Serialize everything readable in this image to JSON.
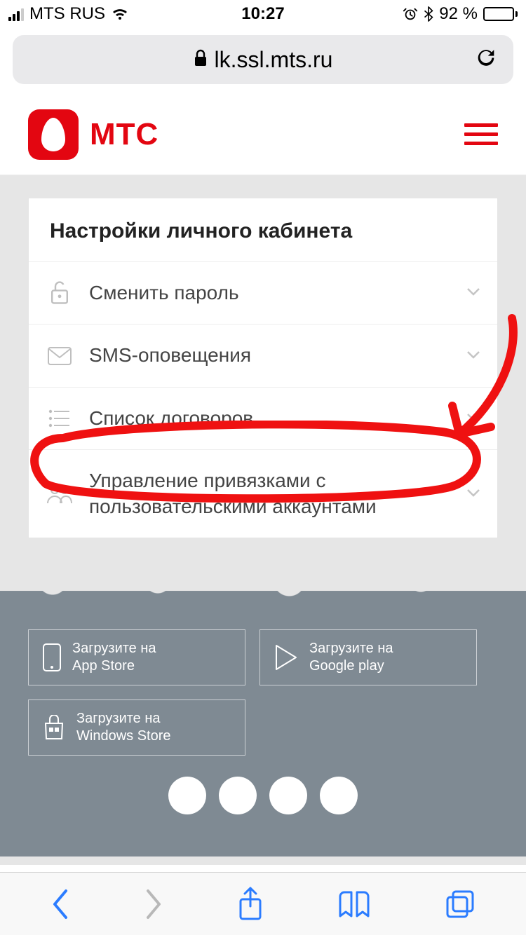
{
  "statusbar": {
    "carrier": "MTS RUS",
    "time": "10:27",
    "battery_pct": "92 %"
  },
  "addressbar": {
    "host": "lk.ssl.mts.ru"
  },
  "header": {
    "brand": "МТС"
  },
  "card": {
    "title": "Настройки личного кабинета",
    "items": [
      {
        "icon": "lock-open-icon",
        "label": "Сменить пароль"
      },
      {
        "icon": "envelope-icon",
        "label": "SMS-оповещения"
      },
      {
        "icon": "list-icon",
        "label": "Список договоров"
      },
      {
        "icon": "users-icon",
        "label": "Управление привязками с пользовательскими аккаунтами"
      }
    ]
  },
  "footer": {
    "download_prefix": "Загрузите на",
    "stores": [
      {
        "name": "App Store"
      },
      {
        "name": "Google play"
      },
      {
        "name": "Windows Store"
      }
    ]
  }
}
